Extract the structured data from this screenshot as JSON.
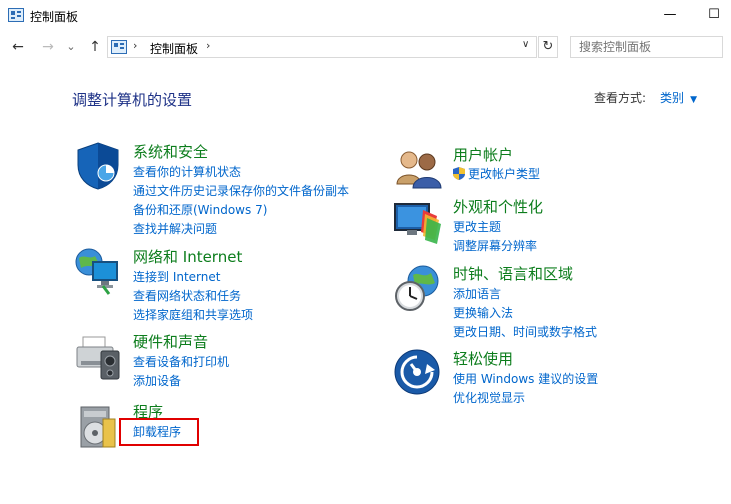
{
  "window": {
    "title": "控制面板",
    "minimize_glyph": "—",
    "maximize_glyph": "☐"
  },
  "address_bar": {
    "back_glyph": "←",
    "forward_glyph": "→",
    "recent_glyph": "⌄",
    "up_glyph": "↑",
    "breadcrumb": "控制面板",
    "separator": "›",
    "dropdown_glyph": "∨",
    "refresh_glyph": "↻",
    "search_placeholder": "搜索控制面板"
  },
  "header": {
    "title": "调整计算机的设置",
    "view_by_label": "查看方式:",
    "view_by_value": "类别"
  },
  "categories": {
    "system": {
      "title": "系统和安全",
      "links": [
        "查看你的计算机状态",
        "通过文件历史记录保存你的文件备份副本",
        "备份和还原(Windows 7)",
        "查找并解决问题"
      ]
    },
    "network": {
      "title": "网络和 Internet",
      "links": [
        "连接到 Internet",
        "查看网络状态和任务",
        "选择家庭组和共享选项"
      ]
    },
    "hardware": {
      "title": "硬件和声音",
      "links": [
        "查看设备和打印机",
        "添加设备"
      ]
    },
    "programs": {
      "title": "程序",
      "links": [
        "卸载程序"
      ]
    },
    "user": {
      "title": "用户帐户",
      "links": [
        "更改帐户类型"
      ]
    },
    "appearance": {
      "title": "外观和个性化",
      "links": [
        "更改主题",
        "调整屏幕分辨率"
      ]
    },
    "clock": {
      "title": "时钟、语言和区域",
      "links": [
        "添加语言",
        "更换输入法",
        "更改日期、时间或数字格式"
      ]
    },
    "ease": {
      "title": "轻松使用",
      "links": [
        "使用 Windows 建议的设置",
        "优化视觉显示"
      ]
    }
  },
  "colors": {
    "category_title": "#0c7d1c",
    "link": "#0066cc",
    "heading": "#1e3287",
    "highlight_box": "#e00000"
  }
}
